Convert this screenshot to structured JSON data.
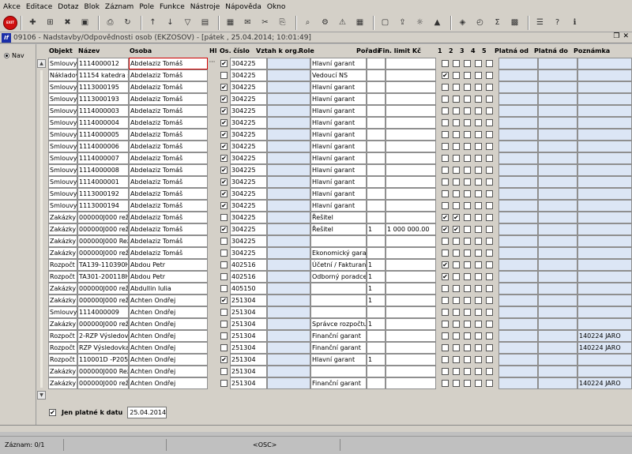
{
  "menu": [
    "Akce",
    "Editace",
    "Dotaz",
    "Blok",
    "Záznam",
    "Pole",
    "Funkce",
    "Nástroje",
    "Nápověda",
    "Okno"
  ],
  "toolbar_icons": [
    "exit-icon",
    "new-record-icon",
    "insert-icon",
    "delete-icon",
    "save-icon",
    "print-icon",
    "refresh-icon",
    "sort-asc-icon",
    "sort-desc-icon",
    "filter-icon",
    "report-icon",
    "print-preview-icon",
    "mail-icon",
    "cut-icon",
    "copy-icon",
    "search-icon",
    "tools-icon",
    "field-icon",
    "calendar-icon",
    "document-icon",
    "export-icon",
    "settings-icon",
    "bookmark-icon",
    "chart-icon",
    "clock-icon",
    "sum-icon",
    "excel-icon",
    "list-icon",
    "help-icon",
    "info-icon"
  ],
  "exit_label": "EXIT",
  "window": {
    "icon_text": "If",
    "title": "09106 - Nadstavby/Odpovědnosti osob (EKZOSOV) - [pátek , 25.04.2014; 10:01:49]",
    "restore": "❐",
    "close": "✕"
  },
  "nav_label": "Nav",
  "columns": [
    "Objekt",
    "Název",
    "Osoba",
    "Hl",
    "Os. číslo",
    "Vztah k org.",
    "Role",
    "Pořadí",
    "Fin. limit Kč",
    "1",
    "2",
    "3",
    "4",
    "5",
    "Platná od",
    "Platná do",
    "Poznámka"
  ],
  "rows": [
    {
      "objekt": "Smlouvy",
      "nazev": "1114000012",
      "osoba": "Abdelaziz Tomáš",
      "hl": true,
      "oscislo": "304225",
      "vztah": "",
      "role": "Hlavní garant",
      "poradi": "",
      "limit": "",
      "c1": false,
      "c2": false,
      "c3": false,
      "c4": false,
      "c5": false,
      "od": "",
      "do": "",
      "pozn": ""
    },
    {
      "objekt": "Nákladov",
      "nazev": "11154 katedra s",
      "osoba": "Abdelaziz Tomáš",
      "hl": false,
      "oscislo": "304225",
      "vztah": "",
      "role": "Vedoucí NS",
      "poradi": "",
      "limit": "",
      "c1": true,
      "c2": false,
      "c3": false,
      "c4": false,
      "c5": false,
      "od": "",
      "do": "",
      "pozn": ""
    },
    {
      "objekt": "Smlouvy",
      "nazev": "1113000195",
      "osoba": "Abdelaziz Tomáš",
      "hl": true,
      "oscislo": "304225",
      "vztah": "",
      "role": "Hlavní garant",
      "poradi": "",
      "limit": "",
      "c1": false,
      "c2": false,
      "c3": false,
      "c4": false,
      "c5": false,
      "od": "",
      "do": "",
      "pozn": ""
    },
    {
      "objekt": "Smlouvy",
      "nazev": "1113000193",
      "osoba": "Abdelaziz Tomáš",
      "hl": true,
      "oscislo": "304225",
      "vztah": "",
      "role": "Hlavní garant",
      "poradi": "",
      "limit": "",
      "c1": false,
      "c2": false,
      "c3": false,
      "c4": false,
      "c5": false,
      "od": "",
      "do": "",
      "pozn": ""
    },
    {
      "objekt": "Smlouvy",
      "nazev": "1114000003",
      "osoba": "Abdelaziz Tomáš",
      "hl": true,
      "oscislo": "304225",
      "vztah": "",
      "role": "Hlavní garant",
      "poradi": "",
      "limit": "",
      "c1": false,
      "c2": false,
      "c3": false,
      "c4": false,
      "c5": false,
      "od": "",
      "do": "",
      "pozn": ""
    },
    {
      "objekt": "Smlouvy",
      "nazev": "1114000004",
      "osoba": "Abdelaziz Tomáš",
      "hl": true,
      "oscislo": "304225",
      "vztah": "",
      "role": "Hlavní garant",
      "poradi": "",
      "limit": "",
      "c1": false,
      "c2": false,
      "c3": false,
      "c4": false,
      "c5": false,
      "od": "",
      "do": "",
      "pozn": ""
    },
    {
      "objekt": "Smlouvy",
      "nazev": "1114000005",
      "osoba": "Abdelaziz Tomáš",
      "hl": true,
      "oscislo": "304225",
      "vztah": "",
      "role": "Hlavní garant",
      "poradi": "",
      "limit": "",
      "c1": false,
      "c2": false,
      "c3": false,
      "c4": false,
      "c5": false,
      "od": "",
      "do": "",
      "pozn": ""
    },
    {
      "objekt": "Smlouvy",
      "nazev": "1114000006",
      "osoba": "Abdelaziz Tomáš",
      "hl": true,
      "oscislo": "304225",
      "vztah": "",
      "role": "Hlavní garant",
      "poradi": "",
      "limit": "",
      "c1": false,
      "c2": false,
      "c3": false,
      "c4": false,
      "c5": false,
      "od": "",
      "do": "",
      "pozn": ""
    },
    {
      "objekt": "Smlouvy",
      "nazev": "1114000007",
      "osoba": "Abdelaziz Tomáš",
      "hl": true,
      "oscislo": "304225",
      "vztah": "",
      "role": "Hlavní garant",
      "poradi": "",
      "limit": "",
      "c1": false,
      "c2": false,
      "c3": false,
      "c4": false,
      "c5": false,
      "od": "",
      "do": "",
      "pozn": ""
    },
    {
      "objekt": "Smlouvy",
      "nazev": "1114000008",
      "osoba": "Abdelaziz Tomáš",
      "hl": true,
      "oscislo": "304225",
      "vztah": "",
      "role": "Hlavní garant",
      "poradi": "",
      "limit": "",
      "c1": false,
      "c2": false,
      "c3": false,
      "c4": false,
      "c5": false,
      "od": "",
      "do": "",
      "pozn": ""
    },
    {
      "objekt": "Smlouvy",
      "nazev": "1114000001",
      "osoba": "Abdelaziz Tomáš",
      "hl": true,
      "oscislo": "304225",
      "vztah": "",
      "role": "Hlavní garant",
      "poradi": "",
      "limit": "",
      "c1": false,
      "c2": false,
      "c3": false,
      "c4": false,
      "c5": false,
      "od": "",
      "do": "",
      "pozn": ""
    },
    {
      "objekt": "Smlouvy",
      "nazev": "1113000192",
      "osoba": "Abdelaziz Tomáš",
      "hl": true,
      "oscislo": "304225",
      "vztah": "",
      "role": "Hlavní garant",
      "poradi": "",
      "limit": "",
      "c1": false,
      "c2": false,
      "c3": false,
      "c4": false,
      "c5": false,
      "od": "",
      "do": "",
      "pozn": ""
    },
    {
      "objekt": "Smlouvy",
      "nazev": "1113000194",
      "osoba": "Abdelaziz Tomáš",
      "hl": true,
      "oscislo": "304225",
      "vztah": "",
      "role": "Hlavní garant",
      "poradi": "",
      "limit": "",
      "c1": false,
      "c2": false,
      "c3": false,
      "c4": false,
      "c5": false,
      "od": "",
      "do": "",
      "pozn": ""
    },
    {
      "objekt": "Zakázky",
      "nazev": "000000J000 rež",
      "osoba": "Abdelaziz Tomáš",
      "hl": false,
      "oscislo": "304225",
      "vztah": "",
      "role": "Řešitel",
      "poradi": "",
      "limit": "",
      "c1": true,
      "c2": true,
      "c3": false,
      "c4": false,
      "c5": false,
      "od": "",
      "do": "",
      "pozn": ""
    },
    {
      "objekt": "Zakázky",
      "nazev": "000000J000 rež",
      "osoba": "Abdelaziz Tomáš",
      "hl": true,
      "oscislo": "304225",
      "vztah": "",
      "role": "Řešitel",
      "poradi": "1",
      "limit": "1 000 000.00",
      "c1": true,
      "c2": true,
      "c3": false,
      "c4": false,
      "c5": false,
      "od": "",
      "do": "",
      "pozn": ""
    },
    {
      "objekt": "Zakázky",
      "nazev": "000000J000 Rež",
      "osoba": "Abdelaziz Tomáš",
      "hl": false,
      "oscislo": "304225",
      "vztah": "",
      "role": "",
      "poradi": "",
      "limit": "",
      "c1": false,
      "c2": false,
      "c3": false,
      "c4": false,
      "c5": false,
      "od": "",
      "do": "",
      "pozn": ""
    },
    {
      "objekt": "Zakázky",
      "nazev": "000000J000 rež",
      "osoba": "Abdelaziz Tomáš",
      "hl": false,
      "oscislo": "304225",
      "vztah": "",
      "role": "Ekonomický garar",
      "poradi": "",
      "limit": "",
      "c1": false,
      "c2": false,
      "c3": false,
      "c4": false,
      "c5": false,
      "od": "",
      "do": "",
      "pozn": ""
    },
    {
      "objekt": "Rozpočt",
      "nazev": "TA139-110390H",
      "osoba": "Abdou Petr",
      "hl": false,
      "oscislo": "402516",
      "vztah": "",
      "role": "Účetní / Fakturant",
      "poradi": "1",
      "limit": "",
      "c1": true,
      "c2": false,
      "c3": false,
      "c4": false,
      "c5": false,
      "od": "",
      "do": "",
      "pozn": ""
    },
    {
      "objekt": "Rozpočt",
      "nazev": "TA301-200118H",
      "osoba": "Abdou Petr",
      "hl": false,
      "oscislo": "402516",
      "vztah": "",
      "role": "Odborný poradce",
      "poradi": "1",
      "limit": "",
      "c1": true,
      "c2": false,
      "c3": false,
      "c4": false,
      "c5": false,
      "od": "",
      "do": "",
      "pozn": ""
    },
    {
      "objekt": "Zakázky",
      "nazev": "000000J000 rež",
      "osoba": "Abdullin Iulia",
      "hl": false,
      "oscislo": "405150",
      "vztah": "",
      "role": "",
      "poradi": "1",
      "limit": "",
      "c1": false,
      "c2": false,
      "c3": false,
      "c4": false,
      "c5": false,
      "od": "",
      "do": "",
      "pozn": ""
    },
    {
      "objekt": "Zakázky",
      "nazev": "000000J000 rež",
      "osoba": "Achten Ondřej",
      "hl": true,
      "oscislo": "251304",
      "vztah": "",
      "role": "",
      "poradi": "1",
      "limit": "",
      "c1": false,
      "c2": false,
      "c3": false,
      "c4": false,
      "c5": false,
      "od": "",
      "do": "",
      "pozn": ""
    },
    {
      "objekt": "Smlouvy",
      "nazev": "1114000009",
      "osoba": "Achten Ondřej",
      "hl": false,
      "oscislo": "251304",
      "vztah": "",
      "role": "",
      "poradi": "",
      "limit": "",
      "c1": false,
      "c2": false,
      "c3": false,
      "c4": false,
      "c5": false,
      "od": "",
      "do": "",
      "pozn": ""
    },
    {
      "objekt": "Zakázky",
      "nazev": "000000J000 rež",
      "osoba": "Achten Ondřej",
      "hl": false,
      "oscislo": "251304",
      "vztah": "",
      "role": "Správce rozpočtu",
      "poradi": "1",
      "limit": "",
      "c1": false,
      "c2": false,
      "c3": false,
      "c4": false,
      "c5": false,
      "od": "",
      "do": "",
      "pozn": ""
    },
    {
      "objekt": "Rozpočt",
      "nazev": "2-RZP Výsledov",
      "osoba": "Achten Ondřej",
      "hl": false,
      "oscislo": "251304",
      "vztah": "",
      "role": "Finanční garant",
      "poradi": "",
      "limit": "",
      "c1": false,
      "c2": false,
      "c3": false,
      "c4": false,
      "c5": false,
      "od": "",
      "do": "",
      "pozn": "140224 JARO"
    },
    {
      "objekt": "Rozpočt",
      "nazev": "RZP Výsledovka",
      "osoba": "Achten Ondřej",
      "hl": false,
      "oscislo": "251304",
      "vztah": "",
      "role": "Finanční garant",
      "poradi": "",
      "limit": "",
      "c1": false,
      "c2": false,
      "c3": false,
      "c4": false,
      "c5": false,
      "od": "",
      "do": "",
      "pozn": "140224 JARO"
    },
    {
      "objekt": "Rozpočt",
      "nazev": "110001D -P205/",
      "osoba": "Achten Ondřej",
      "hl": true,
      "oscislo": "251304",
      "vztah": "",
      "role": "Hlavní garant",
      "poradi": "1",
      "limit": "",
      "c1": false,
      "c2": false,
      "c3": false,
      "c4": false,
      "c5": false,
      "od": "",
      "do": "",
      "pozn": ""
    },
    {
      "objekt": "Zakázky",
      "nazev": "000000J000 Rež",
      "osoba": "Achten Ondřej",
      "hl": false,
      "oscislo": "251304",
      "vztah": "",
      "role": "",
      "poradi": "",
      "limit": "",
      "c1": false,
      "c2": false,
      "c3": false,
      "c4": false,
      "c5": false,
      "od": "",
      "do": "",
      "pozn": ""
    },
    {
      "objekt": "Zakázky",
      "nazev": "000000J000 rež",
      "osoba": "Achten Ondřej",
      "hl": false,
      "oscislo": "251304",
      "vztah": "",
      "role": "Finanční garant",
      "poradi": "",
      "limit": "",
      "c1": false,
      "c2": false,
      "c3": false,
      "c4": false,
      "c5": false,
      "od": "",
      "do": "",
      "pozn": "140224 JARO"
    }
  ],
  "filter": {
    "checked": true,
    "label": "Jen platné k datu",
    "date": "25.04.2014"
  },
  "status": {
    "record": "Záznam: 0/1",
    "osc": "<OSC>"
  },
  "check_mark": "✔",
  "dots_label": "···"
}
